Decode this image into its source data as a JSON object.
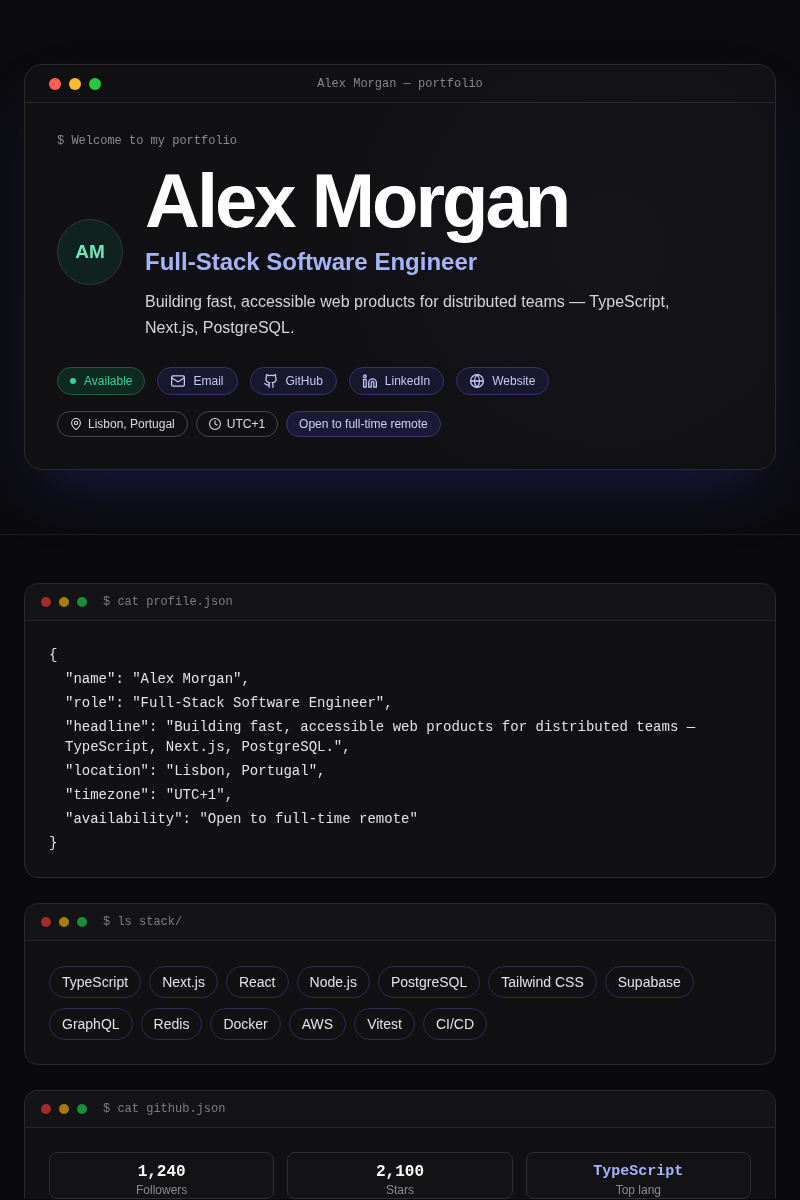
{
  "hero": {
    "window_title": "Alex Morgan — portfolio",
    "prompt": "$ Welcome to my portfolio",
    "avatar_initials": "AM",
    "name": "Alex Morgan",
    "role": "Full-Stack Software Engineer",
    "headline": "Building fast, accessible web products for distributed teams — TypeScript, Next.js, PostgreSQL.",
    "status": {
      "label": "Available",
      "available": true
    },
    "links": [
      {
        "kind": "email",
        "label": "Email"
      },
      {
        "kind": "github",
        "label": "GitHub"
      },
      {
        "kind": "linkedin",
        "label": "LinkedIn"
      },
      {
        "kind": "website",
        "label": "Website"
      }
    ],
    "meta": [
      {
        "kind": "location",
        "label": "Lisbon, Portugal"
      },
      {
        "kind": "timezone",
        "label": "UTC+1"
      },
      {
        "kind": "availability",
        "label": "Open to full-time remote"
      }
    ]
  },
  "profile_card": {
    "command": "$ cat profile.json",
    "open": "{",
    "entries": [
      "\"name\": \"Alex Morgan\",",
      "\"role\": \"Full-Stack Software Engineer\",",
      "\"headline\": \"Building fast, accessible web products for distributed teams — TypeScript, Next.js, PostgreSQL.\",",
      "\"location\": \"Lisbon, Portugal\",",
      "\"timezone\": \"UTC+1\",",
      "\"availability\": \"Open to full-time remote\""
    ],
    "close": "}"
  },
  "stack_card": {
    "command": "$ ls stack/",
    "tags": [
      "TypeScript",
      "Next.js",
      "React",
      "Node.js",
      "PostgreSQL",
      "Tailwind CSS",
      "Supabase",
      "GraphQL",
      "Redis",
      "Docker",
      "AWS",
      "Vitest",
      "CI/CD"
    ]
  },
  "github_card": {
    "command": "$ cat github.json",
    "stats": [
      {
        "kind": "count",
        "value": "1,240",
        "label": "Followers"
      },
      {
        "kind": "count",
        "value": "2,100",
        "label": "Stars"
      },
      {
        "kind": "language",
        "value": "TypeScript",
        "label": "Top lang"
      }
    ]
  }
}
